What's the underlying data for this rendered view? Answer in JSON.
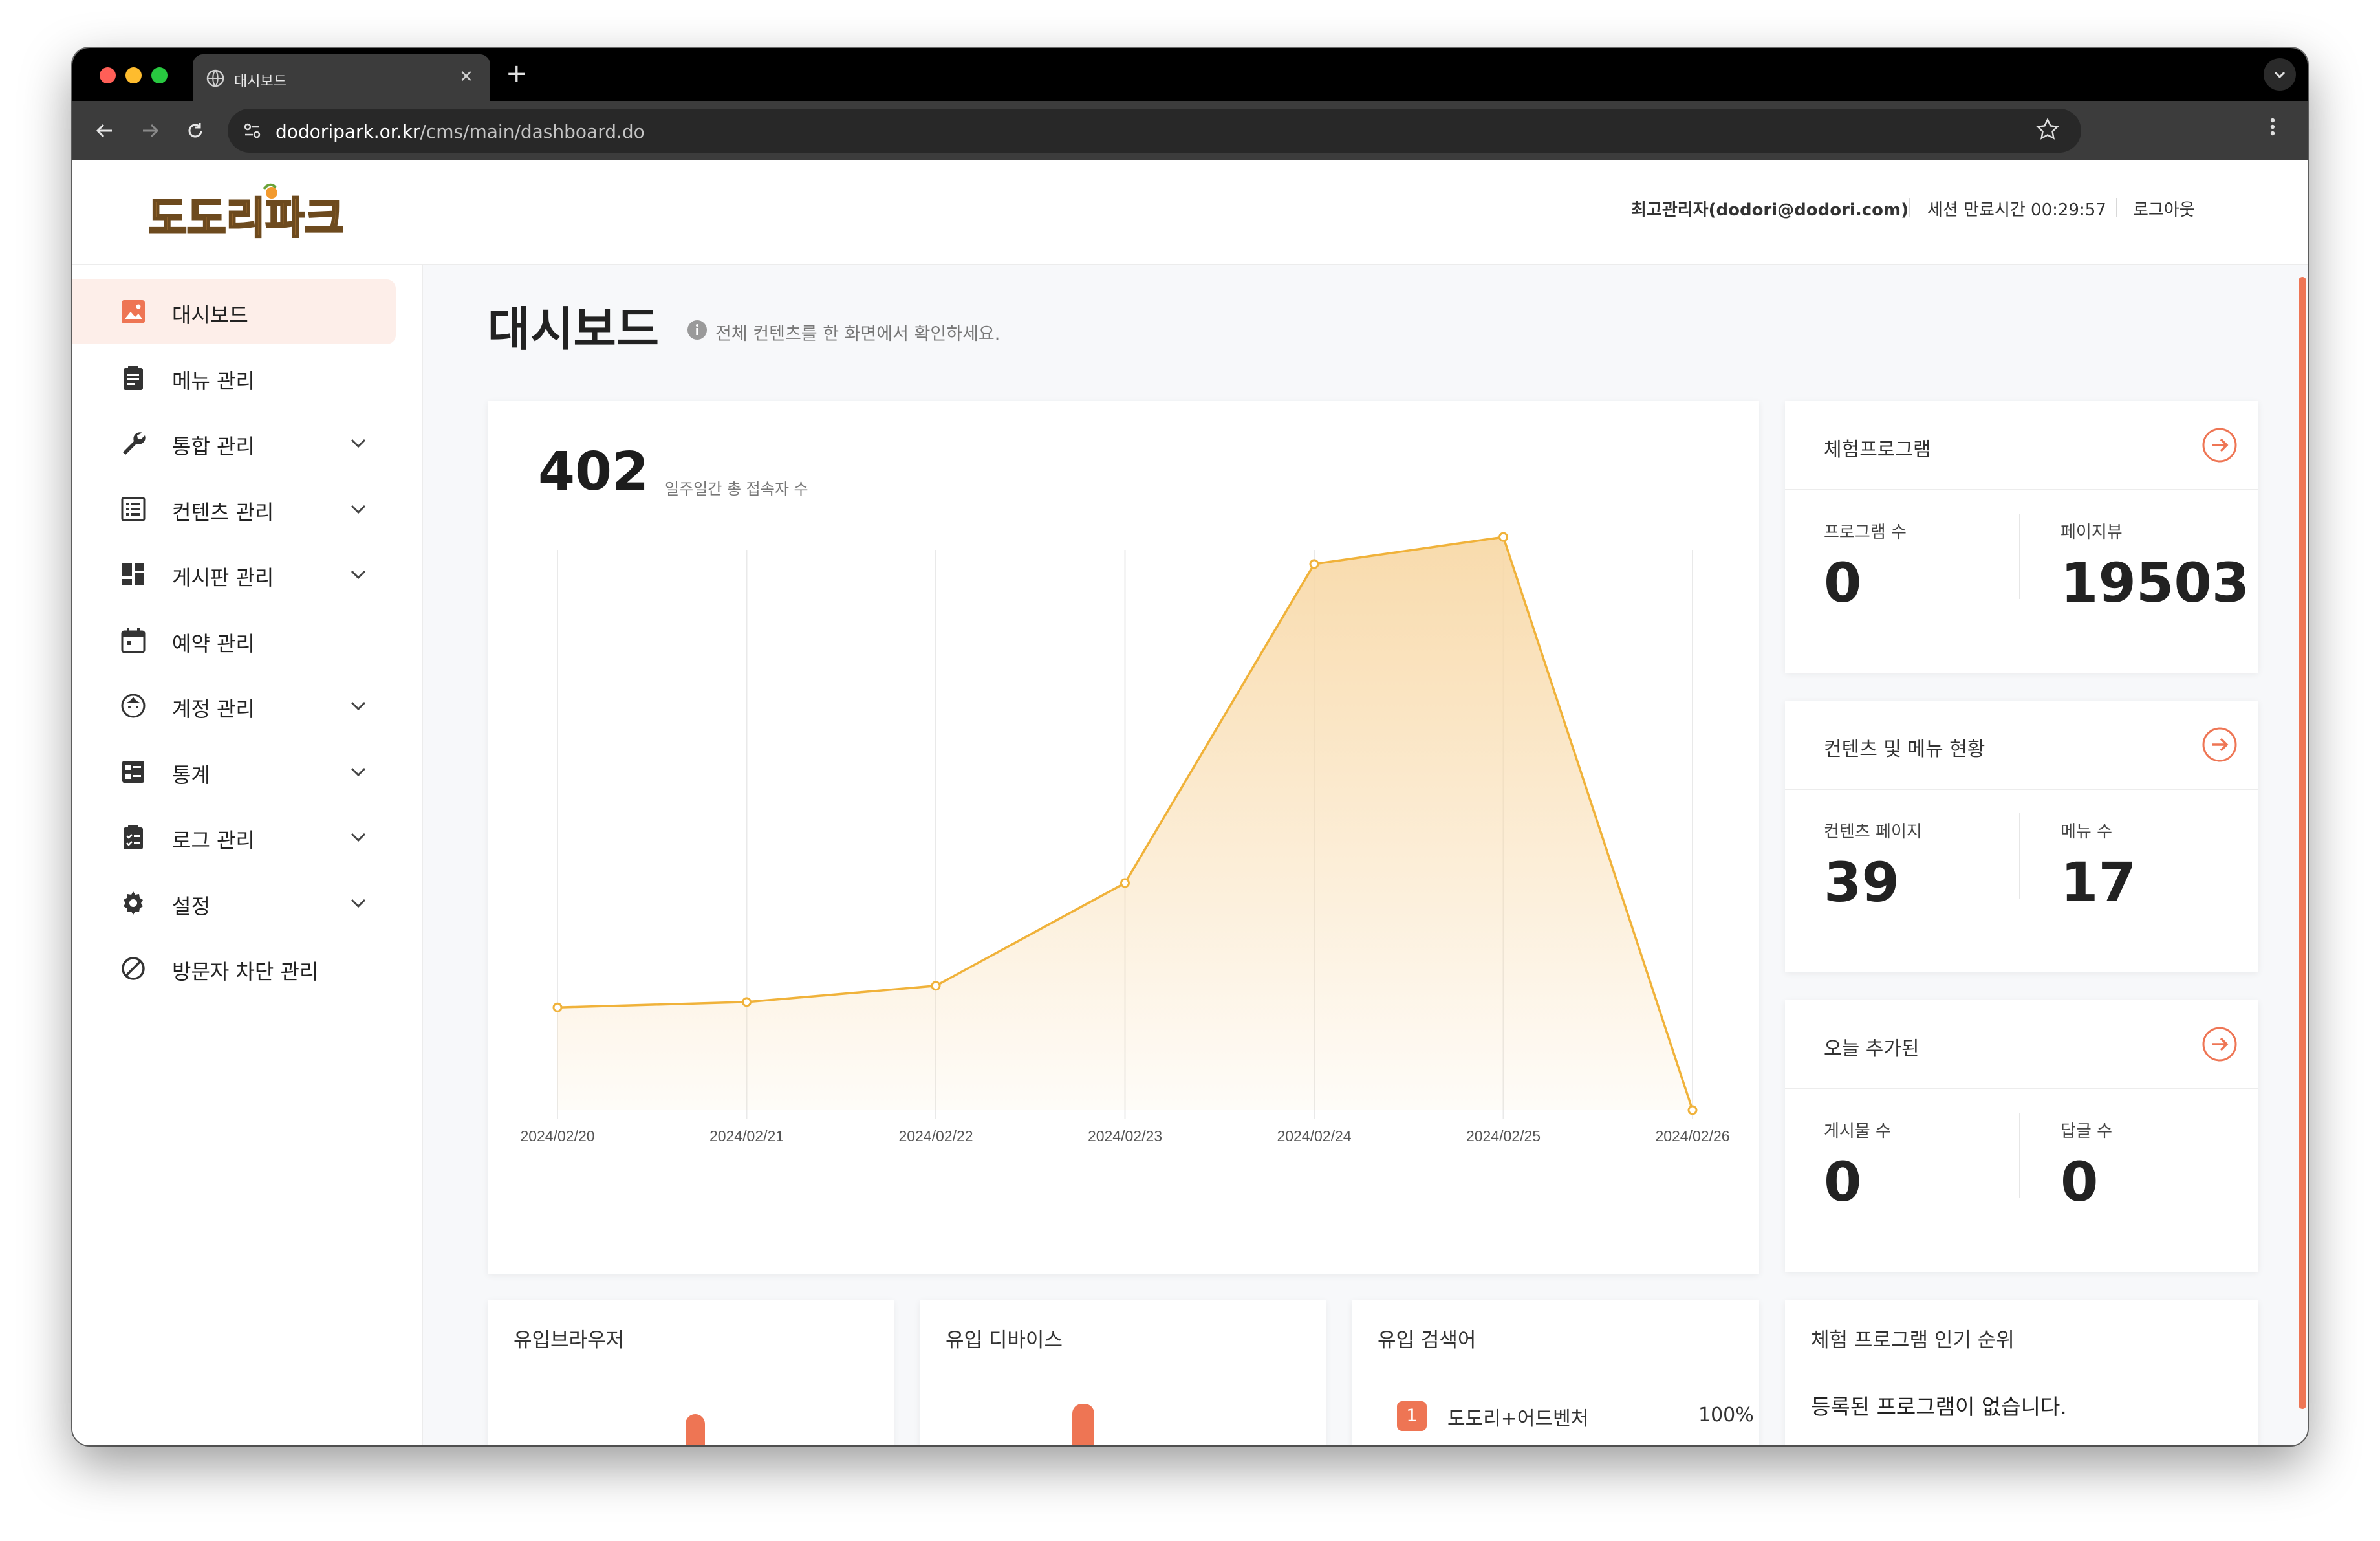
{
  "browser": {
    "tab_title": "대시보드",
    "new_tab": "+",
    "tab_close": "✕",
    "url_host": "dodoripark.or.kr",
    "url_path": "/cms/main/dashboard.do"
  },
  "header": {
    "user": "최고관리자(dodori@dodori.com)",
    "session": "세션 만료시간 00:29:57",
    "logout": "로그아웃",
    "logo_text": "도도리파크"
  },
  "sidebar": {
    "items": [
      {
        "label": "대시보드",
        "icon": "image-icon",
        "active": true,
        "expandable": false
      },
      {
        "label": "메뉴 관리",
        "icon": "clipboard-icon",
        "active": false,
        "expandable": false
      },
      {
        "label": "통합 관리",
        "icon": "wrench-icon",
        "active": false,
        "expandable": true
      },
      {
        "label": "컨텐츠 관리",
        "icon": "list-icon",
        "active": false,
        "expandable": true
      },
      {
        "label": "게시판 관리",
        "icon": "dashboard-grid-icon",
        "active": false,
        "expandable": true
      },
      {
        "label": "예약 관리",
        "icon": "calendar-icon",
        "active": false,
        "expandable": false
      },
      {
        "label": "계정 관리",
        "icon": "face-icon",
        "active": false,
        "expandable": true
      },
      {
        "label": "통계",
        "icon": "stats-icon",
        "active": false,
        "expandable": true
      },
      {
        "label": "로그 관리",
        "icon": "clipboard-check-icon",
        "active": false,
        "expandable": true
      },
      {
        "label": "설정",
        "icon": "gear-icon",
        "active": false,
        "expandable": true
      },
      {
        "label": "방문자 차단 관리",
        "icon": "block-icon",
        "active": false,
        "expandable": false
      }
    ]
  },
  "main": {
    "title": "대시보드",
    "description": "전체 컨텐츠를 한 화면에서 확인하세요.",
    "visitors": {
      "total": "402",
      "label": "일주일간 총 접속자 수"
    },
    "stats": [
      {
        "title": "체험프로그램",
        "left_label": "프로그램 수",
        "left_value": "0",
        "right_label": "페이지뷰",
        "right_value": "19503"
      },
      {
        "title": "컨텐츠 및 메뉴 현황",
        "left_label": "컨텐츠 페이지",
        "left_value": "39",
        "right_label": "메뉴 수",
        "right_value": "17"
      },
      {
        "title": "오늘 추가된",
        "left_label": "게시물 수",
        "left_value": "0",
        "right_label": "답글 수",
        "right_value": "0"
      }
    ],
    "bottom": {
      "browser_title": "유입브라우저",
      "device_title": "유입 디바이스",
      "keyword_title": "유입 검색어",
      "keywords": [
        {
          "rank": "1",
          "name": "도도리+어드벤처",
          "pct": "100%"
        }
      ],
      "ranking_title": "체험 프로그램 인기 순위",
      "ranking_empty": "등록된 프로그램이 없습니다."
    }
  },
  "colors": {
    "accent": "#ee7554",
    "line": "#f0b23a",
    "area": "#f8d9a8"
  },
  "chart_data": {
    "type": "area",
    "x": [
      "2024/02/20",
      "2024/02/21",
      "2024/02/22",
      "2024/02/23",
      "2024/02/24",
      "2024/02/25",
      "2024/02/26"
    ],
    "series": [
      {
        "values": [
          19,
          20,
          23,
          42,
          101,
          106,
          0
        ]
      }
    ],
    "ylim": [
      0,
      112
    ],
    "grid": "vertical"
  }
}
